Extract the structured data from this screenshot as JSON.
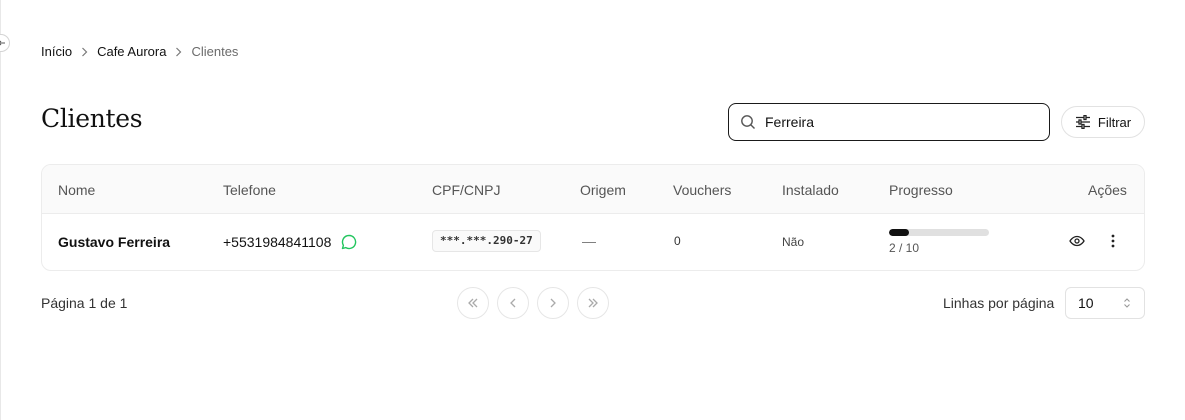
{
  "breadcrumb": {
    "items": [
      "Início",
      "Cafe Aurora",
      "Clientes"
    ]
  },
  "page": {
    "title": "Clientes"
  },
  "search": {
    "value": "Ferreira",
    "icon": "search-icon"
  },
  "filter": {
    "label": "Filtrar",
    "icon": "sliders-icon"
  },
  "table": {
    "columns": [
      "Nome",
      "Telefone",
      "CPF/CNPJ",
      "Origem",
      "Vouchers",
      "Instalado",
      "Progresso",
      "Ações"
    ],
    "rows": [
      {
        "nome": "Gustavo Ferreira",
        "telefone": "+5531984841108",
        "cpf": "***.***.290-27",
        "origem": "—",
        "vouchers": "0",
        "instalado": "Não",
        "progress_text": "2 / 10",
        "progress_fraction": 0.2
      }
    ]
  },
  "pagination": {
    "info": "Página 1 de 1",
    "rows_per_page_label": "Linhas por página",
    "rows_per_page_value": "10"
  },
  "colors": {
    "whatsapp": "#22c55e",
    "progress_fill": "#111111",
    "progress_track": "#e0e0e0"
  }
}
